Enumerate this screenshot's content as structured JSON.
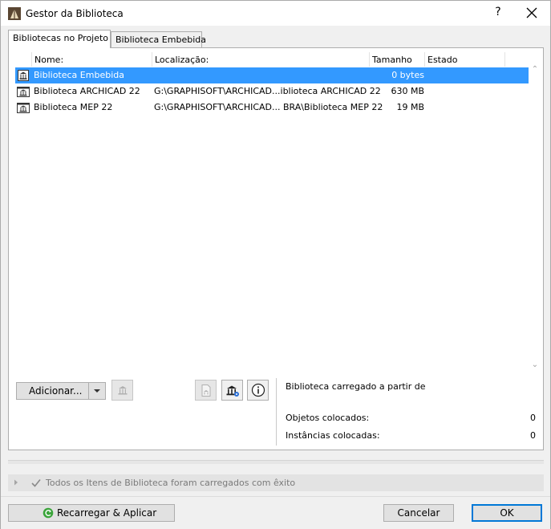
{
  "window": {
    "title": "Gestor da Biblioteca",
    "help_label": "?"
  },
  "tabs": [
    {
      "label": "Bibliotecas no Projeto",
      "active": true
    },
    {
      "label": "Biblioteca Embebida",
      "active": false
    }
  ],
  "table": {
    "columns": [
      "Nome:",
      "Localização:",
      "Tamanho",
      "Estado"
    ],
    "rows": [
      {
        "name": "Biblioteca Embebida",
        "location": "",
        "size": "0 bytes",
        "state": "",
        "selected": true,
        "icon": "embedded-library-icon"
      },
      {
        "name": "Biblioteca ARCHICAD 22",
        "location": "G:\\GRAPHISOFT\\ARCHICAD...iblioteca ARCHICAD 22",
        "size": "630 MB",
        "state": "",
        "selected": false,
        "icon": "library-icon"
      },
      {
        "name": "Biblioteca MEP 22",
        "location": "G:\\GRAPHISOFT\\ARCHICAD... BRA\\Biblioteca MEP 22",
        "size": "19 MB",
        "state": "",
        "selected": false,
        "icon": "library-icon"
      }
    ]
  },
  "actions": {
    "add_label": "Adicionar...",
    "dropdown_icon": "chevron-down-icon",
    "remove_icon": "remove-library-icon",
    "embed_icon": "embed-file-icon",
    "library_settings_icon": "library-settings-icon",
    "info_icon": "info-icon"
  },
  "details": {
    "loaded_from_label": "Biblioteca carregado a partir de",
    "placed_objects_label": "Objetos colocados:",
    "placed_objects_value": "0",
    "placed_instances_label": "Instâncias colocadas:",
    "placed_instances_value": "0"
  },
  "status": {
    "message": "Todos os Itens de Biblioteca foram carregados com êxito",
    "icon": "checkmark-icon"
  },
  "footer": {
    "reload_label": "Recarregar & Aplicar",
    "reload_icon": "reload-icon",
    "cancel_label": "Cancelar",
    "ok_label": "OK"
  },
  "colors": {
    "selection": "#3399ff",
    "ok_border": "#0078d7",
    "reload_icon": "#3aa43a"
  }
}
